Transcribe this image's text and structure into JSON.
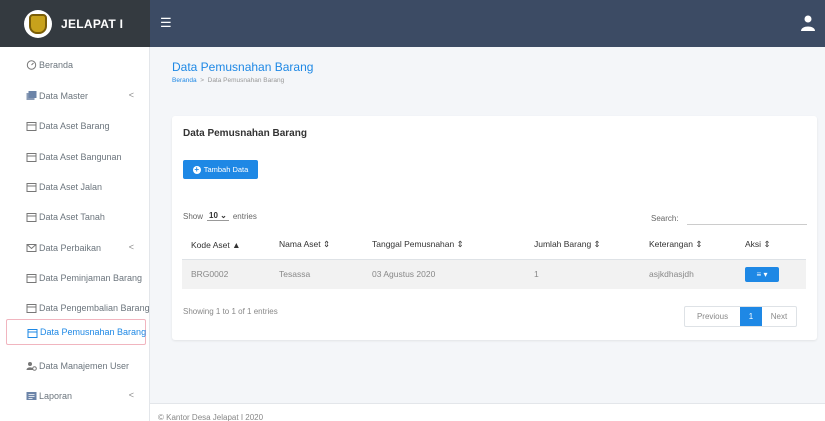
{
  "header": {
    "brand": "JELAPAT I",
    "menu_icon": "hamburger-icon",
    "user_icon": "user-icon"
  },
  "sidebar": {
    "items": [
      {
        "label": "Beranda",
        "icon": "dashboard-icon"
      },
      {
        "label": "Data Master",
        "icon": "folders-icon",
        "chevron": "<"
      },
      {
        "label": "Data Aset Barang",
        "icon": "calendar-icon"
      },
      {
        "label": "Data Aset Bangunan",
        "icon": "calendar-icon"
      },
      {
        "label": "Data Aset Jalan",
        "icon": "calendar-icon"
      },
      {
        "label": "Data Aset Tanah",
        "icon": "calendar-icon"
      },
      {
        "label": "Data Perbaikan",
        "icon": "envelope-icon",
        "chevron": "<"
      },
      {
        "label": "Data Peminjaman Barang",
        "icon": "calendar-icon"
      },
      {
        "label": "Data Pengembalian Barang",
        "icon": "calendar-icon"
      },
      {
        "label": "Data Pemusnahan Barang",
        "icon": "calendar-icon",
        "active": true
      },
      {
        "label": "Data Manajemen User",
        "icon": "users-icon"
      },
      {
        "label": "Laporan",
        "icon": "report-icon",
        "chevron": "<"
      }
    ]
  },
  "page": {
    "title": "Data Pemusnahan Barang",
    "breadcrumb_home": "Beranda",
    "breadcrumb_sep": ">",
    "breadcrumb_current": "Data Pemusnahan Barang"
  },
  "card": {
    "title": "Data Pemusnahan Barang",
    "add_button": "Tambah Data",
    "show_label": "Show",
    "show_value": "10",
    "entries_label": "entries",
    "search_label": "Search:",
    "search_value": "",
    "columns": [
      "Kode Aset",
      "Nama Aset",
      "Tanggal Pemusnahan",
      "Jumlah Barang",
      "Keterangan",
      "Aksi"
    ],
    "rows": [
      {
        "kode": "BRG0002",
        "nama": "Tesassa",
        "tanggal": "03 Agustus 2020",
        "jumlah": "1",
        "keterangan": "asjkdhasjdh",
        "aksi": "≡ ▾"
      }
    ],
    "info": "Showing 1 to 1 of 1 entries",
    "pagination": {
      "previous": "Previous",
      "current": "1",
      "next": "Next"
    }
  },
  "footer": {
    "text": "© Kantor Desa Jelapat I 2020"
  },
  "colors": {
    "accent": "#1e88e5",
    "topbar": "#3c4b64",
    "brand_bg": "#343a40"
  }
}
